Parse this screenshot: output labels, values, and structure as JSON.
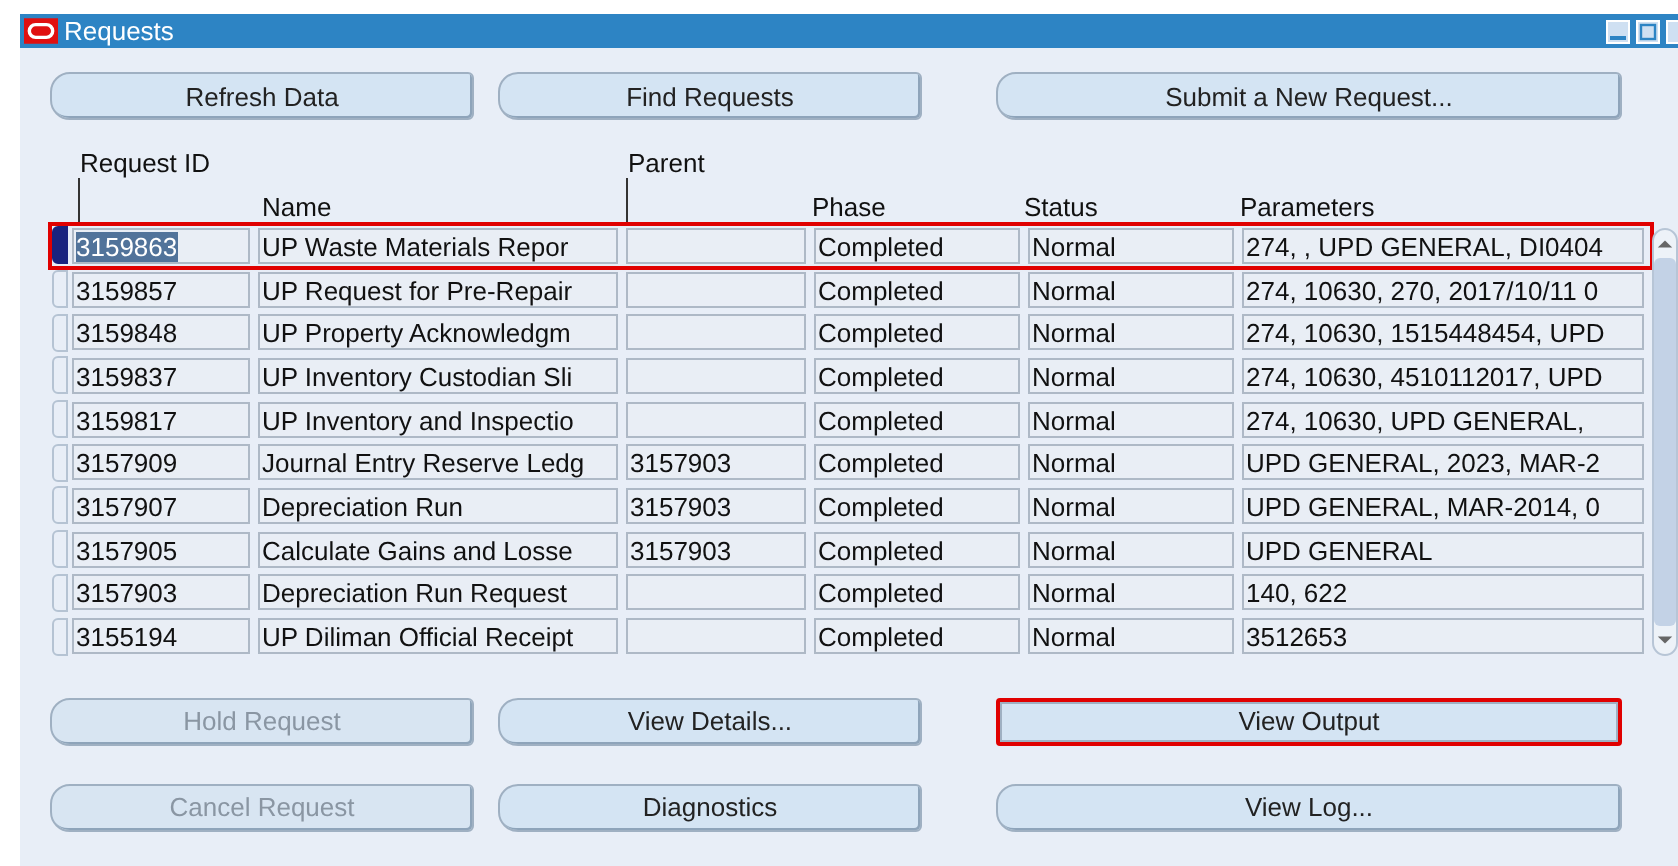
{
  "window": {
    "title": "Requests"
  },
  "top_buttons": [
    {
      "label": "Refresh Data"
    },
    {
      "label": "Find Requests"
    },
    {
      "label": "Submit a New Request..."
    }
  ],
  "table": {
    "columns": {
      "request_id": "Request ID",
      "name": "Name",
      "parent": "Parent",
      "phase": "Phase",
      "status": "Status",
      "parameters": "Parameters"
    },
    "rows": [
      {
        "request_id": "3159863",
        "name": "UP Waste Materials Repor",
        "parent": "",
        "phase": "Completed",
        "status": "Normal",
        "parameters": "274, , UPD GENERAL, DI0404",
        "selected": true,
        "highlighted": true
      },
      {
        "request_id": "3159857",
        "name": "UP Request for Pre-Repair",
        "parent": "",
        "phase": "Completed",
        "status": "Normal",
        "parameters": "274, 10630, 270, 2017/10/11 0",
        "selected": false,
        "highlighted": false
      },
      {
        "request_id": "3159848",
        "name": "UP Property Acknowledgm",
        "parent": "",
        "phase": "Completed",
        "status": "Normal",
        "parameters": "274, 10630, 1515448454, UPD",
        "selected": false,
        "highlighted": false
      },
      {
        "request_id": "3159837",
        "name": "UP Inventory Custodian Sli",
        "parent": "",
        "phase": "Completed",
        "status": "Normal",
        "parameters": "274, 10630, 4510112017, UPD",
        "selected": false,
        "highlighted": false
      },
      {
        "request_id": "3159817",
        "name": "UP Inventory and Inspectio",
        "parent": "",
        "phase": "Completed",
        "status": "Normal",
        "parameters": "274, 10630, UPD GENERAL,",
        "selected": false,
        "highlighted": false
      },
      {
        "request_id": "3157909",
        "name": "Journal Entry Reserve Ledg",
        "parent": "3157903",
        "phase": "Completed",
        "status": "Normal",
        "parameters": "UPD GENERAL, 2023, MAR-2",
        "selected": false,
        "highlighted": false
      },
      {
        "request_id": "3157907",
        "name": "Depreciation Run",
        "parent": "3157903",
        "phase": "Completed",
        "status": "Normal",
        "parameters": "UPD GENERAL, MAR-2014, 0",
        "selected": false,
        "highlighted": false
      },
      {
        "request_id": "3157905",
        "name": "Calculate Gains and Losse",
        "parent": "3157903",
        "phase": "Completed",
        "status": "Normal",
        "parameters": "UPD GENERAL",
        "selected": false,
        "highlighted": false
      },
      {
        "request_id": "3157903",
        "name": "Depreciation Run Request",
        "parent": "",
        "phase": "Completed",
        "status": "Normal",
        "parameters": "140, 622",
        "selected": false,
        "highlighted": false
      },
      {
        "request_id": "3155194",
        "name": "UP Diliman Official Receipt",
        "parent": "",
        "phase": "Completed",
        "status": "Normal",
        "parameters": "3512653",
        "selected": false,
        "highlighted": false
      }
    ]
  },
  "bottom_buttons": [
    [
      {
        "label": "Hold Request",
        "disabled": true,
        "highlighted": false
      },
      {
        "label": "View Details...",
        "disabled": false,
        "highlighted": false
      },
      {
        "label": "View Output",
        "disabled": false,
        "highlighted": true
      }
    ],
    [
      {
        "label": "Cancel Request",
        "disabled": true,
        "highlighted": false
      },
      {
        "label": "Diagnostics",
        "disabled": false,
        "highlighted": false
      },
      {
        "label": "View Log...",
        "disabled": false,
        "highlighted": false
      }
    ]
  ]
}
